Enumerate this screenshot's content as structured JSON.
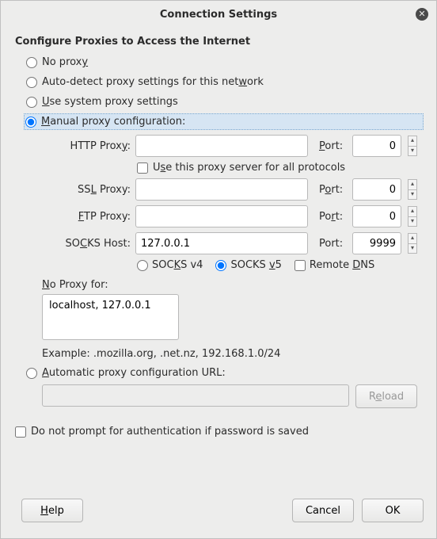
{
  "title": "Connection Settings",
  "heading": "Configure Proxies to Access the Internet",
  "radios": {
    "no_proxy": "No prox",
    "no_proxy_u": "y",
    "auto_detect_pre": "Auto-detect proxy settings for this net",
    "auto_detect_u": "w",
    "auto_detect_post": "ork",
    "system_u": "U",
    "system_post": "se system proxy settings",
    "manual_u": "M",
    "manual_post": "anual proxy configuration:",
    "pac_u": "A",
    "pac_post": "utomatic proxy configuration URL:"
  },
  "labels": {
    "http": "HTTP Prox",
    "http_u": "y",
    "ssl_pre": "SS",
    "ssl_u": "L",
    "ssl_post": " Proxy:",
    "ftp_u": "F",
    "ftp_post": "TP Proxy:",
    "socks_pre": "SO",
    "socks_u": "C",
    "socks_post": "KS Host:",
    "port_pre": "P",
    "port_u": "o",
    "port_post": "rt:",
    "port2_pre": "Po",
    "port2_u": "r",
    "port2_post": "t:",
    "port_plain": "Port:",
    "use_all_pre": "U",
    "use_all_u": "s",
    "use_all_post": "e this proxy server for all protocols",
    "socks4_pre": "SOC",
    "socks4_u": "K",
    "socks4_post": "S v4",
    "socks5_pre": "SOCKS ",
    "socks5_u": "v",
    "socks5_post": "5",
    "remote_pre": "Remote ",
    "remote_u": "D",
    "remote_post": "NS",
    "np_u": "N",
    "np_post": "o Proxy for:",
    "example": "Example: .mozilla.org, .net.nz, 192.168.1.0/24",
    "reload_pre": "R",
    "reload_u": "e",
    "reload_post": "load",
    "noprompt": "Do not prompt for authentication if password is saved",
    "help_pre": "",
    "help_u": "H",
    "help_post": "elp",
    "cancel": "Cancel",
    "ok": "OK"
  },
  "values": {
    "http_host": "",
    "http_port": "0",
    "ssl_host": "",
    "ssl_port": "0",
    "ftp_host": "",
    "ftp_port": "0",
    "socks_host": "127.0.0.1",
    "socks_port": "9999",
    "no_proxy": "localhost, 127.0.0.1",
    "pac_url": ""
  },
  "state": {
    "selected_radio": "manual",
    "use_all": false,
    "socks_version": "v5",
    "remote_dns": false,
    "noprompt": false
  }
}
